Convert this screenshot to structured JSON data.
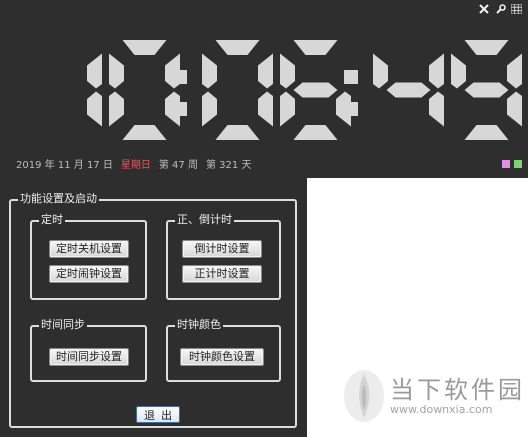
{
  "clock": {
    "time": {
      "h": "10",
      "m": "06",
      "s": "49"
    },
    "date_line": {
      "year": "2019",
      "year_unit": "年",
      "month": "11",
      "month_unit": "月",
      "day": "17",
      "day_unit": "日",
      "weekday": "星期日",
      "week_prefix": "第",
      "week": "47",
      "week_unit": "周",
      "day_prefix": "第",
      "day_of_year": "321",
      "day_of_year_unit": "天"
    },
    "colors": {
      "background": "#2e2e2e",
      "digit": "#d7d7d7",
      "weekday": "#e35a58",
      "swatch_1": "#e38de6",
      "swatch_2": "#7cd46e"
    },
    "controls": {
      "close_icon": "close-icon",
      "wrench_icon": "wrench-icon",
      "grid_icon": "grid-icon"
    }
  },
  "settings": {
    "main_group_label": "功能设置及启动",
    "timer_group": {
      "label": "定时",
      "buttons": [
        "定时关机设置",
        "定时闹钟设置"
      ]
    },
    "countdown_group": {
      "label": "正、倒计时",
      "buttons": [
        "倒计时设置",
        "正计时设置"
      ]
    },
    "sync_group": {
      "label": "时间同步",
      "buttons": [
        "时间同步设置"
      ]
    },
    "color_group": {
      "label": "时钟颜色",
      "buttons": [
        "时钟颜色设置"
      ]
    },
    "exit_label": "退出"
  },
  "watermark": {
    "title": "当下软件园",
    "url": "www.downxia.com"
  }
}
